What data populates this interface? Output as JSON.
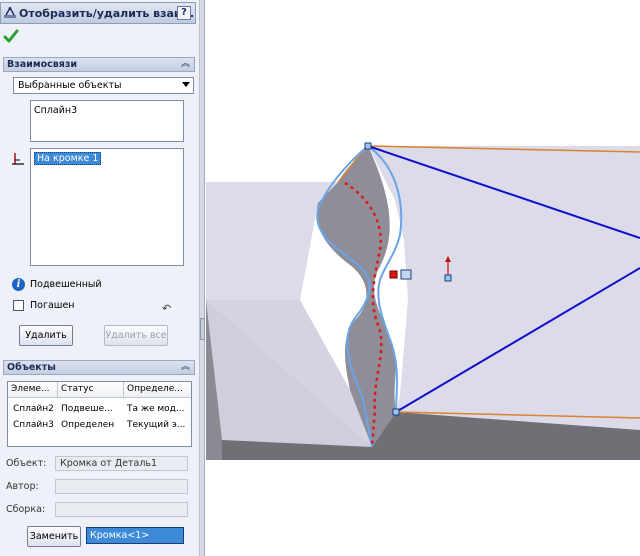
{
  "panel": {
    "title": "Отобразить/удалить взаи...",
    "help_label": "?",
    "ok_icon": "check-icon",
    "relations": {
      "header": "Взаимосвязи",
      "filter_value": "Выбранные объекты",
      "selected_entities": [
        "Сплайн3"
      ],
      "relations_list": [
        "На кромке 1"
      ],
      "status_text": "Подвешенный",
      "suppressed_label": "Погашен",
      "delete_label": "Удалить",
      "delete_all_label": "Удалить все"
    },
    "objects": {
      "header": "Объекты",
      "columns": [
        "Элеме...",
        "Статус",
        "Определе..."
      ],
      "rows": [
        [
          "Сплайн2",
          "Подвеше...",
          "Та же мод..."
        ],
        [
          "Сплайн3",
          "Определен",
          "Текущий э..."
        ]
      ],
      "object_label": "Объект:",
      "object_value": "Кромка от Деталь1",
      "author_label": "Автор:",
      "author_value": "",
      "assembly_label": "Сборка:",
      "assembly_value": "",
      "replace_label": "Заменить",
      "replace_target": "Кромка<1>"
    }
  },
  "viewport": {
    "colors": {
      "background": "#ffffff",
      "top_face": "#dcdbe9",
      "side_face": "#6f6f76",
      "pocket_face": "#8e8d98",
      "sketch_line": "#1010cc",
      "spline_curve": "#6aa5e8",
      "edge_highlight": "#d9852d",
      "dangling_relation": "#e01515"
    }
  }
}
